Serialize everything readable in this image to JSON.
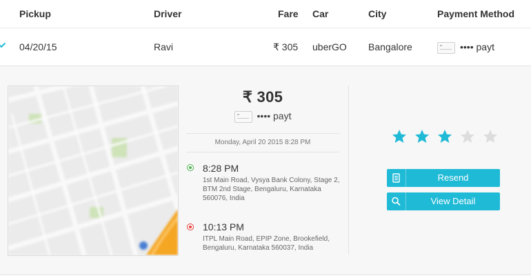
{
  "table": {
    "headers": {
      "pickup": "Pickup",
      "driver": "Driver",
      "fare": "Fare",
      "car": "Car",
      "city": "City",
      "payment_method": "Payment Method"
    },
    "row": {
      "pickup": "04/20/15",
      "driver": "Ravi",
      "fare": "₹ 305",
      "car": "uberGO",
      "city": "Bangalore",
      "payment": "•••• payt"
    }
  },
  "detail": {
    "fare": "₹ 305",
    "payment": "•••• payt",
    "datetime": "Monday, April 20 2015 8:28 PM",
    "pickup": {
      "time": "8:28 PM",
      "address": "1st Main Road, Vysya Bank Colony, Stage 2, BTM 2nd Stage, Bengaluru, Karnataka 560076, India"
    },
    "dropoff": {
      "time": "10:13 PM",
      "address": "ITPL Main Road, EPIP Zone, Brookefield, Bengaluru, Karnataka 560037, India"
    },
    "rating": {
      "value": 3,
      "max": 5
    },
    "buttons": {
      "resend": "Resend",
      "view_detail": "View Detail"
    }
  },
  "icons": {
    "expand": "chevron-down-icon",
    "card": "credit-card-icon",
    "pickup": "pickup-dot-icon",
    "dropoff": "dropoff-dot-icon",
    "star": "star-icon",
    "resend": "document-icon",
    "view_detail": "search-icon"
  },
  "colors": {
    "accent": "#1fbad6",
    "star_filled": "#1fbad6",
    "star_empty": "#dddddd",
    "pickup": "#4caf50",
    "dropoff": "#e53935",
    "route": "#f5a623"
  }
}
